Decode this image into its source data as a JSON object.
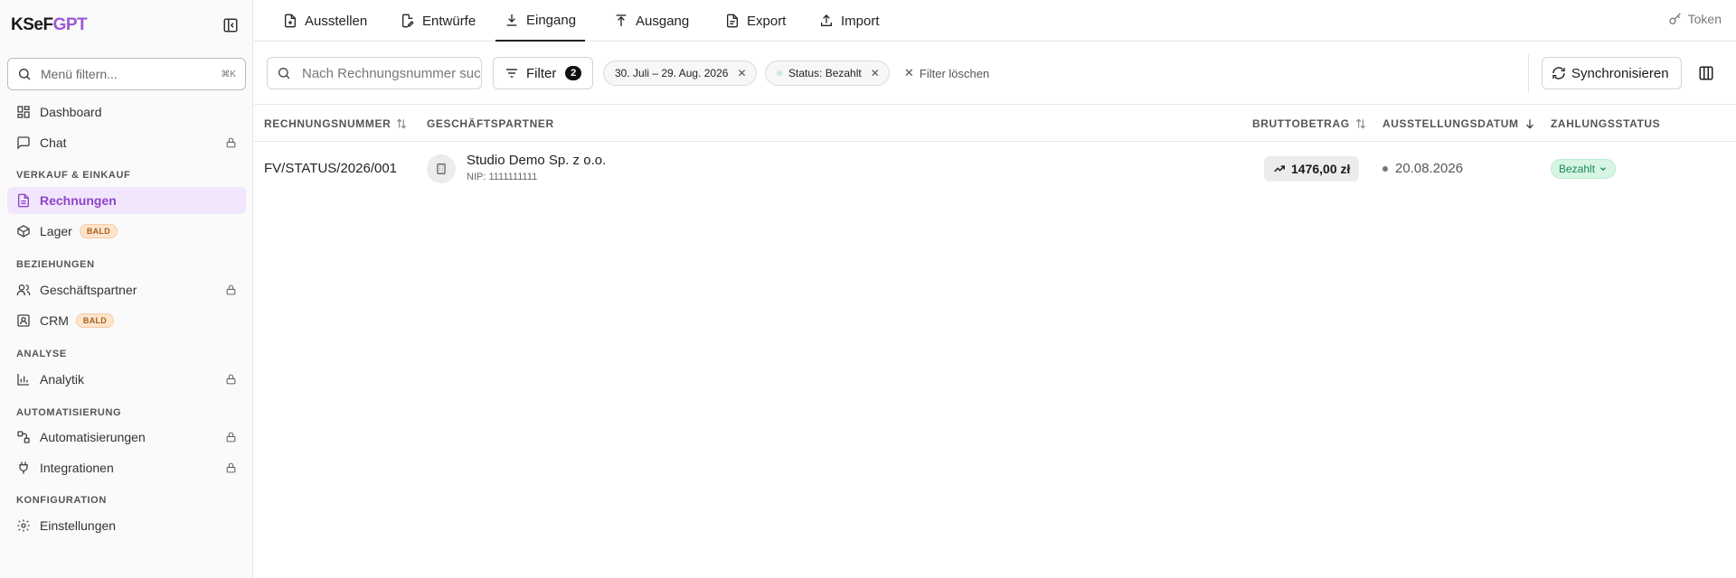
{
  "app": {
    "logo_main": "KSeF",
    "logo_accent": "GPT"
  },
  "sidebar": {
    "search_placeholder": "Menü filtern...",
    "search_shortcut": "⌘K",
    "items": [
      {
        "label": "Dashboard"
      },
      {
        "label": "Chat"
      },
      {
        "label": "Rechnungen"
      },
      {
        "label": "Lager",
        "badge": "BALD"
      },
      {
        "label": "Geschäftspartner"
      },
      {
        "label": "CRM",
        "badge": "BALD"
      },
      {
        "label": "Analytik"
      },
      {
        "label": "Automatisierungen"
      },
      {
        "label": "Integrationen"
      },
      {
        "label": "Einstellungen"
      }
    ],
    "sections": [
      "VERKAUF & EINKAUF",
      "BEZIEHUNGEN",
      "ANALYSE",
      "AUTOMATISIERUNG",
      "KONFIGURATION"
    ]
  },
  "tabs": [
    {
      "label": "Ausstellen"
    },
    {
      "label": "Entwürfe"
    },
    {
      "label": "Eingang"
    },
    {
      "label": "Ausgang"
    },
    {
      "label": "Export"
    },
    {
      "label": "Import"
    }
  ],
  "header": {
    "token_label": "Token"
  },
  "filters": {
    "search_placeholder": "Nach Rechnungsnummer suchen",
    "filter_label": "Filter",
    "filter_count": "2",
    "chips": [
      {
        "label": "30. Juli – 29. Aug. 2026"
      },
      {
        "label": "Status: Bezahlt"
      }
    ],
    "clear_label": "Filter löschen",
    "sync_label": "Synchronisieren"
  },
  "table": {
    "headers": [
      "RECHNUNGSNUMMER",
      "GESCHÄFTSPARTNER",
      "BRUTTOBETRAG",
      "AUSSTELLUNGSDATUM",
      "ZAHLUNGSSTATUS"
    ],
    "rows": [
      {
        "number": "FV/STATUS/2026/001",
        "partner": "Studio Demo Sp. z o.o.",
        "nip": "NIP: 1111111111",
        "amount": "1476,00 zł",
        "date": "20.08.2026",
        "status": "Bezahlt"
      }
    ]
  },
  "colors": {
    "accent": "#8e44c9",
    "status_paid_bg": "#d6f5e4",
    "status_paid_text": "#1d8a51"
  }
}
